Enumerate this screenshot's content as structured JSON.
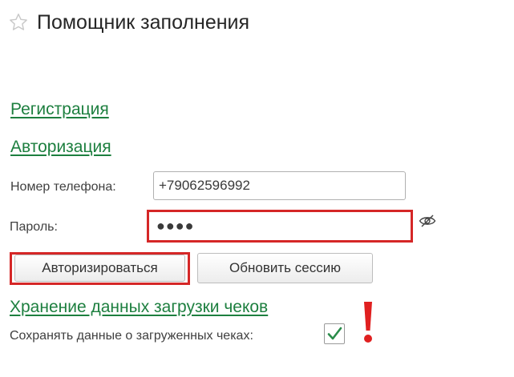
{
  "header": {
    "title": "Помощник заполнения",
    "favorite_icon": "star-outline-icon"
  },
  "links": {
    "registration": "Регистрация",
    "authorization": "Авторизация",
    "receipts_storage": "Хранение данных загрузки чеков"
  },
  "form": {
    "phone_label": "Номер телефона:",
    "phone_value": "+79062596992",
    "password_label": "Пароль:",
    "password_value": "●●●●",
    "show_password_icon": "eye-off-icon",
    "save_receipts_label": "Сохранять данные о загруженных чеках:",
    "save_receipts_checked": true
  },
  "buttons": {
    "authorize": "Авторизироваться",
    "refresh_session": "Обновить сессию"
  },
  "annotations": {
    "highlight_color": "#d52727",
    "exclamation_icon": "exclamation-mark-icon"
  },
  "colors": {
    "link": "#1d7f3f",
    "checkmark": "#2a8c4a"
  }
}
